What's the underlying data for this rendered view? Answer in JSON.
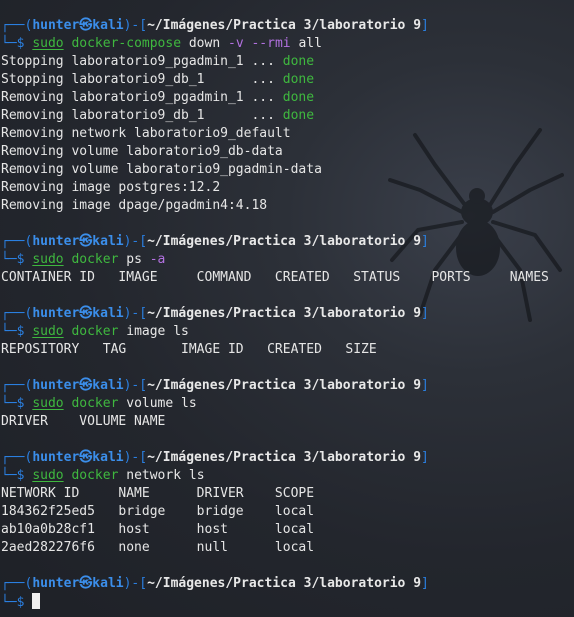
{
  "prompt": {
    "frame_top_open": "┌──(",
    "user": "hunter",
    "at_symbol": "㉿",
    "host": "kali",
    "frame_mid": ")-[",
    "path": "~/Imágenes/Practica 3/laboratorio 9",
    "frame_close": "]",
    "frame_bottom": "└─",
    "dollar": "$ "
  },
  "commands": [
    {
      "sudo": "sudo",
      "cmd": "docker-compose",
      "args": [
        {
          "t": "down",
          "flag": false
        },
        {
          "t": "-v",
          "flag": true
        },
        {
          "t": "--rmi",
          "flag": true
        },
        {
          "t": "all",
          "flag": false
        }
      ]
    },
    {
      "sudo": "sudo",
      "cmd": "docker",
      "args": [
        {
          "t": "ps",
          "flag": false
        },
        {
          "t": "-a",
          "flag": true
        }
      ]
    },
    {
      "sudo": "sudo",
      "cmd": "docker",
      "args": [
        {
          "t": "image",
          "flag": false
        },
        {
          "t": "ls",
          "flag": false
        }
      ]
    },
    {
      "sudo": "sudo",
      "cmd": "docker",
      "args": [
        {
          "t": "volume",
          "flag": false
        },
        {
          "t": "ls",
          "flag": false
        }
      ]
    },
    {
      "sudo": "sudo",
      "cmd": "docker",
      "args": [
        {
          "t": "network",
          "flag": false
        },
        {
          "t": "ls",
          "flag": false
        }
      ]
    }
  ],
  "outputs": {
    "compose_down": [
      {
        "text": "Stopping laboratorio9_pgadmin_1 ... ",
        "status": "done"
      },
      {
        "text": "Stopping laboratorio9_db_1      ... ",
        "status": "done"
      },
      {
        "text": "Removing laboratorio9_pgadmin_1 ... ",
        "status": "done"
      },
      {
        "text": "Removing laboratorio9_db_1      ... ",
        "status": "done"
      },
      {
        "text": "Removing network laboratorio9_default",
        "status": ""
      },
      {
        "text": "Removing volume laboratorio9_db-data",
        "status": ""
      },
      {
        "text": "Removing volume laboratorio9_pgadmin-data",
        "status": ""
      },
      {
        "text": "Removing image postgres:12.2",
        "status": ""
      },
      {
        "text": "Removing image dpage/pgadmin4:4.18",
        "status": ""
      }
    ],
    "ps_header": "CONTAINER ID   IMAGE     COMMAND   CREATED   STATUS    PORTS     NAMES",
    "image_header": "REPOSITORY   TAG       IMAGE ID   CREATED   SIZE",
    "volume_header": "DRIVER    VOLUME NAME",
    "network_header": "NETWORK ID     NAME      DRIVER    SCOPE",
    "network_rows": [
      "184362f25ed5   bridge    bridge    local",
      "ab10a0b28cf1   host      host      local",
      "2aed282276f6   none      null      local"
    ]
  },
  "colors": {
    "prompt_frame": "#2a7fe0",
    "command": "#3fb83f",
    "flag": "#b271e0",
    "done": "#3fb83f",
    "background": "#23262d"
  },
  "icons": {
    "background_art": "spider-wallpaper",
    "cursor": "block-cursor"
  }
}
